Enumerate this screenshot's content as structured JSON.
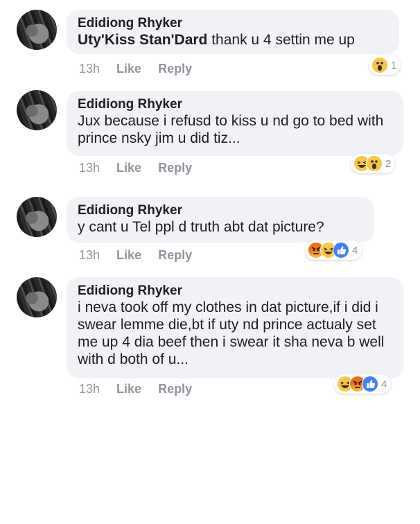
{
  "comments": [
    {
      "author": "Edidiong Rhyker",
      "mention": "Uty'Kiss Stan'Dard",
      "text": " thank u 4 settin me up",
      "time": "13h",
      "like": "Like",
      "reply": "Reply",
      "reactions": [
        "wow"
      ],
      "reaction_count": "1"
    },
    {
      "author": "Edidiong Rhyker",
      "text": "Jux because i refusd to kiss u nd go to bed with prince nsky jim u did tiz...",
      "time": "13h",
      "like": "Like",
      "reply": "Reply",
      "reactions": [
        "haha",
        "wow"
      ],
      "reaction_count": "2"
    },
    {
      "author": "Edidiong Rhyker",
      "text": "y cant u Tel ppl d truth abt dat picture?",
      "time": "13h",
      "like": "Like",
      "reply": "Reply",
      "reactions": [
        "angry",
        "haha",
        "like"
      ],
      "reaction_count": "4"
    },
    {
      "author": "Edidiong Rhyker",
      "text": "i neva took off my clothes in dat picture,if i did i swear lemme die,bt if uty nd prince actualy set me up 4 dia beef then i swear it sha neva b well with d both of u...",
      "time": "13h",
      "like": "Like",
      "reply": "Reply",
      "reactions": [
        "haha",
        "angry",
        "like"
      ],
      "reaction_count": "4"
    }
  ],
  "colors": {
    "bubble": "#f1f2f6",
    "meta": "#90949c",
    "like_blue": "#4080ff",
    "emoji_yellow": "#f7c744"
  }
}
